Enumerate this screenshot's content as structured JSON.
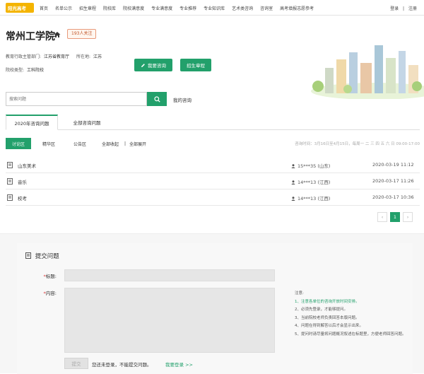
{
  "topnav": {
    "logo_text": "阳光高考",
    "items": [
      "首页",
      "名单公示",
      "招生章程",
      "院校库",
      "院校满意度",
      "专业满意度",
      "专业推荐",
      "专业知识库",
      "艺术类咨询",
      "咨询室",
      "高考填报志愿参考"
    ],
    "login": "登录",
    "separator": "|",
    "register": "注册"
  },
  "header": {
    "school_name": "常州工学院",
    "follow_badge": "193人关注",
    "dept_label": "教育行政主管部门:",
    "dept_value": "江苏省教育厅",
    "location_label": "所在地:",
    "location_value": "江苏",
    "type_label": "院校类型:",
    "type_value": "工科院校",
    "consult_button": "我要咨询",
    "rules_button": "招生章程"
  },
  "search": {
    "placeholder": "搜索问题",
    "my_consult": "我的咨询"
  },
  "tabs": [
    "2020年咨询问题",
    "全部咨询问题"
  ],
  "subtabs": {
    "items": [
      "讨论区",
      "精华区",
      "公告区"
    ],
    "collapse": "全部收起",
    "separator": "|",
    "expand": "全部展开",
    "consult_time": "咨询时间：3月16日至4月15日，每周一 二 三 四 五 六 日 09:00-17:00"
  },
  "questions": [
    {
      "title": "山东美术",
      "user": "15***35 (山东)",
      "time": "2020-03-19 11:12"
    },
    {
      "title": "音乐",
      "user": "14***13 (江西)",
      "time": "2020-03-17 11:26"
    },
    {
      "title": "校考",
      "user": "14***13 (江西)",
      "time": "2020-03-17 10:36"
    }
  ],
  "pagination": {
    "prev": "‹",
    "current": "1",
    "next": "›"
  },
  "submit": {
    "heading": "提交问题",
    "required_mark": "*",
    "title_label": "标题:",
    "content_label": "内容:",
    "notes_title": "注意:",
    "notes": [
      "1、注意各单位的咨询开放时间安排。",
      "2、必须先登录，才能够提问。",
      "3、当前院校老师负责回答本版问题。",
      "4、问题在得到解答以后才会显示出来。",
      "5、提问时请尽量将问题概况叙述在标题里，方便老师回答问题。"
    ],
    "submit_button": "提交",
    "not_logged_msg": "您还未登录，不能提交问题。",
    "login_link": "我要登录 >>"
  },
  "colors": {
    "accent": "#22a06b",
    "badge_border": "#e89a7a"
  }
}
